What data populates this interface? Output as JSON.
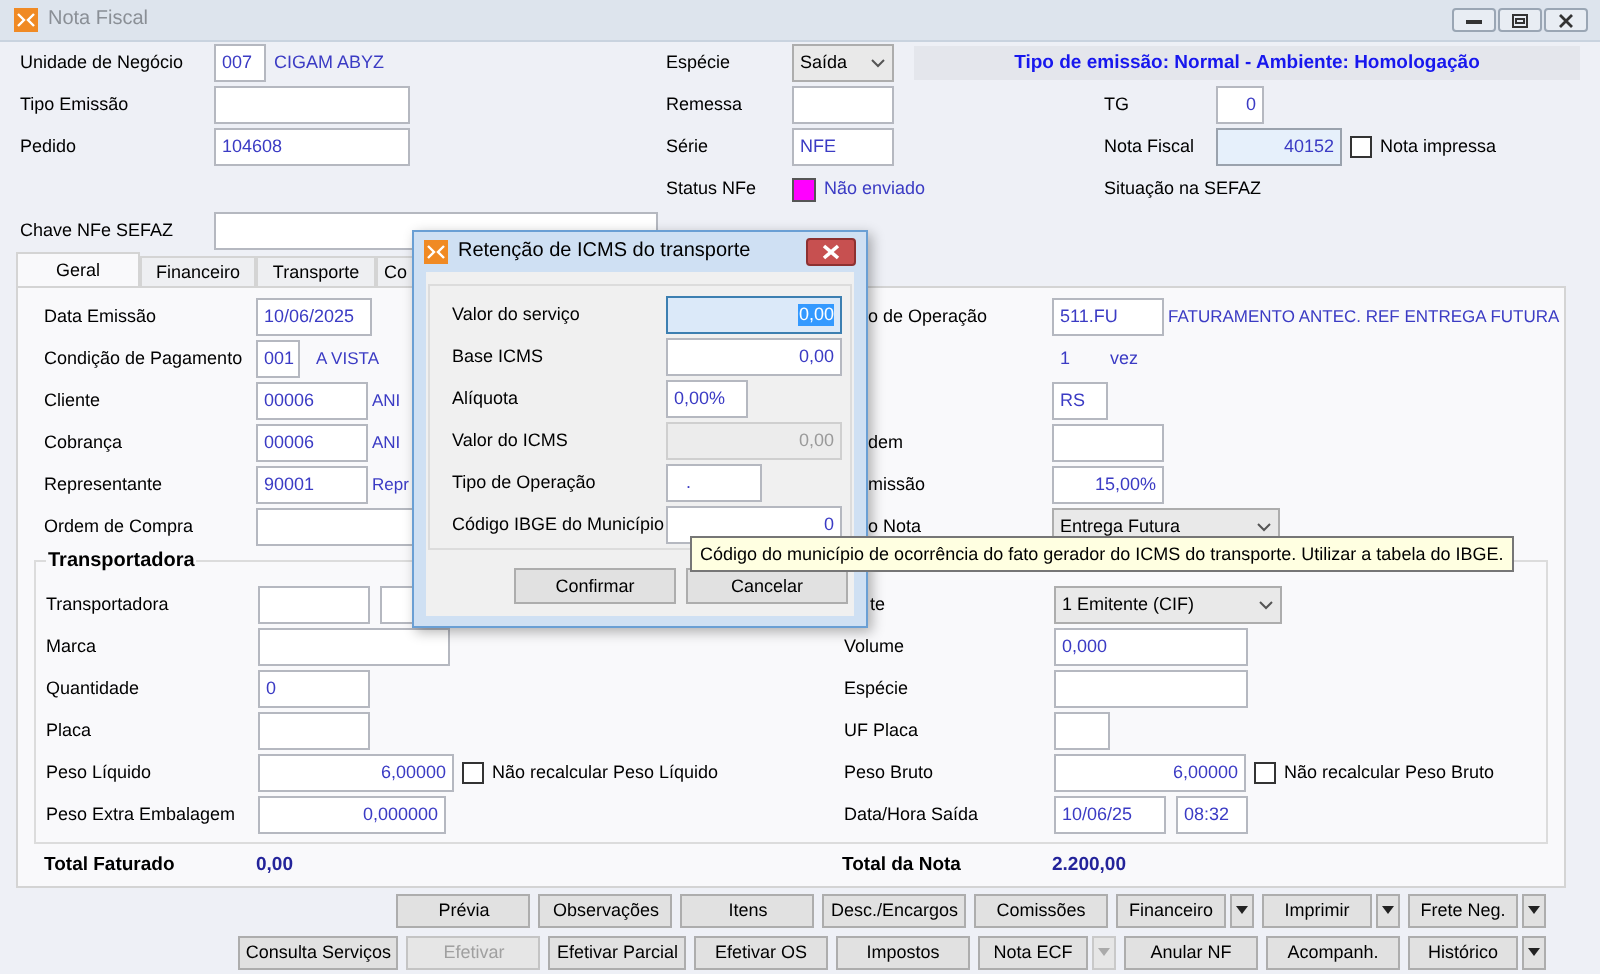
{
  "window": {
    "title": "Nota Fiscal"
  },
  "header": {
    "unidade": {
      "label": "Unidade de Negócio",
      "code": "007",
      "name": "CIGAM ABYZ"
    },
    "tipo_emissao": {
      "label": "Tipo Emissão"
    },
    "pedido": {
      "label": "Pedido",
      "value": "104608"
    },
    "chave": {
      "label": "Chave NFe SEFAZ"
    },
    "especie": {
      "label": "Espécie",
      "value": "Saída"
    },
    "remessa": {
      "label": "Remessa"
    },
    "serie": {
      "label": "Série",
      "value": "NFE"
    },
    "status": {
      "label": "Status NFe",
      "color": "#ff00ff",
      "text": "Não enviado"
    },
    "banner": "Tipo de emissão: Normal - Ambiente: Homologação",
    "tg": {
      "label": "TG",
      "value": "0"
    },
    "nota_fiscal": {
      "label": "Nota Fiscal",
      "value": "40152",
      "printed_label": "Nota impressa",
      "printed": false
    },
    "situacao": {
      "label": "Situação na SEFAZ"
    }
  },
  "tabs": [
    {
      "label": "Geral",
      "selected": true
    },
    {
      "label": "Financeiro",
      "selected": false
    },
    {
      "label": "Transporte",
      "selected": false
    },
    {
      "label": "Co",
      "selected": false
    }
  ],
  "general": {
    "left": [
      {
        "kind": "input",
        "label": "Data Emissão",
        "value": "10/06/2025"
      },
      {
        "kind": "code",
        "label": "Condição de Pagamento",
        "code": "001",
        "name": "A VISTA"
      },
      {
        "kind": "code",
        "label": "Cliente",
        "code": "00006",
        "name": "ANI"
      },
      {
        "kind": "code",
        "label": "Cobrança",
        "code": "00006",
        "name": "ANI"
      },
      {
        "kind": "code",
        "label": "Representante",
        "code": "90001",
        "name": "Repr"
      },
      {
        "kind": "input",
        "label": "Ordem de Compra"
      }
    ],
    "right": [
      {
        "kind": "code",
        "label": "o de Operação",
        "code": "511.FU",
        "name": "FATURAMENTO ANTEC. REF ENTREGA FUTURA"
      },
      {
        "kind": "count",
        "value": "1",
        "unit": "vez"
      },
      {
        "kind": "input",
        "value": "RS"
      },
      {
        "kind": "input",
        "label": "dem"
      },
      {
        "kind": "input",
        "label": "missão",
        "value": "15,00%"
      },
      {
        "kind": "select",
        "label": "o Nota",
        "value": "Entrega Futura"
      }
    ],
    "carrier": {
      "title": "Transportadora",
      "left": [
        {
          "kind": "pair",
          "label": "Transportadora"
        },
        {
          "kind": "input",
          "label": "Marca"
        },
        {
          "kind": "input",
          "label": "Quantidade",
          "value": "0"
        },
        {
          "kind": "input",
          "label": "Placa"
        },
        {
          "kind": "check",
          "label": "Peso Líquido",
          "value": "6,00000",
          "recalc_label": "Não recalcular Peso Líquido",
          "recalc": false
        },
        {
          "kind": "input",
          "label": "Peso Extra Embalagem",
          "value": "0,000000"
        }
      ],
      "right": [
        {
          "kind": "select",
          "label": "te",
          "value": "1 Emitente (CIF)"
        },
        {
          "kind": "input",
          "label": "Volume",
          "value": "0,000"
        },
        {
          "kind": "input",
          "label": "Espécie"
        },
        {
          "kind": "input",
          "label": "UF Placa"
        },
        {
          "kind": "check",
          "label": "Peso Bruto",
          "value": "6,00000",
          "recalc_label": "Não recalcular Peso Bruto",
          "recalc": false
        },
        {
          "kind": "datetime",
          "label": "Data/Hora Saída",
          "date": "10/06/25",
          "time": "08:32"
        }
      ]
    },
    "totals": [
      {
        "label": "Total Faturado",
        "value": "0,00"
      },
      {
        "label": "Total da Nota",
        "value": "2.200,00"
      }
    ]
  },
  "button_rows": [
    [
      {
        "label": "Prévia",
        "disabled": false
      },
      {
        "label": "Observações",
        "disabled": false
      },
      {
        "label": "Itens",
        "disabled": false
      },
      {
        "label": "Desc./Encargos",
        "disabled": false
      },
      {
        "label": "Comissões",
        "disabled": false
      },
      {
        "label": "Financeiro",
        "disabled": false,
        "menu": true,
        "menu_disabled": false
      },
      {
        "label": "Imprimir",
        "disabled": false,
        "menu": true,
        "menu_disabled": false
      },
      {
        "label": "Frete Neg.",
        "disabled": false,
        "menu": true,
        "menu_disabled": false
      }
    ],
    [
      {
        "label": "Consulta Serviços",
        "disabled": false
      },
      {
        "label": "Efetivar",
        "disabled": true
      },
      {
        "label": "Efetivar Parcial",
        "disabled": false
      },
      {
        "label": "Efetivar OS",
        "disabled": false
      },
      {
        "label": "Impostos",
        "disabled": false
      },
      {
        "label": "Nota ECF",
        "disabled": false,
        "menu": true,
        "menu_disabled": true
      },
      {
        "label": "Anular NF",
        "disabled": false
      },
      {
        "label": "Acompanh.",
        "disabled": false
      },
      {
        "label": "Histórico",
        "disabled": false,
        "menu": true,
        "menu_disabled": false
      }
    ]
  ],
  "dialog": {
    "title": "Retenção de ICMS do transporte",
    "fields": [
      {
        "label": "Valor do serviço",
        "value": "0,00",
        "focused": true,
        "disabled": false
      },
      {
        "label": "Base ICMS",
        "value": "0,00",
        "focused": false,
        "disabled": false
      },
      {
        "label": "Alíquota",
        "value": "0,00%",
        "focused": false,
        "disabled": false
      },
      {
        "label": "Valor do ICMS",
        "value": "0,00",
        "focused": false,
        "disabled": true
      },
      {
        "label": "Tipo de Operação",
        "value": ".",
        "focused": false,
        "disabled": false
      },
      {
        "label": "Código IBGE do Município",
        "value": "0",
        "focused": false,
        "disabled": false
      }
    ],
    "buttons": [
      "Confirmar",
      "Cancelar"
    ],
    "tooltip": "Código do município de ocorrência do fato gerador do ICMS do transporte. Utilizar a tabela do IBGE."
  }
}
